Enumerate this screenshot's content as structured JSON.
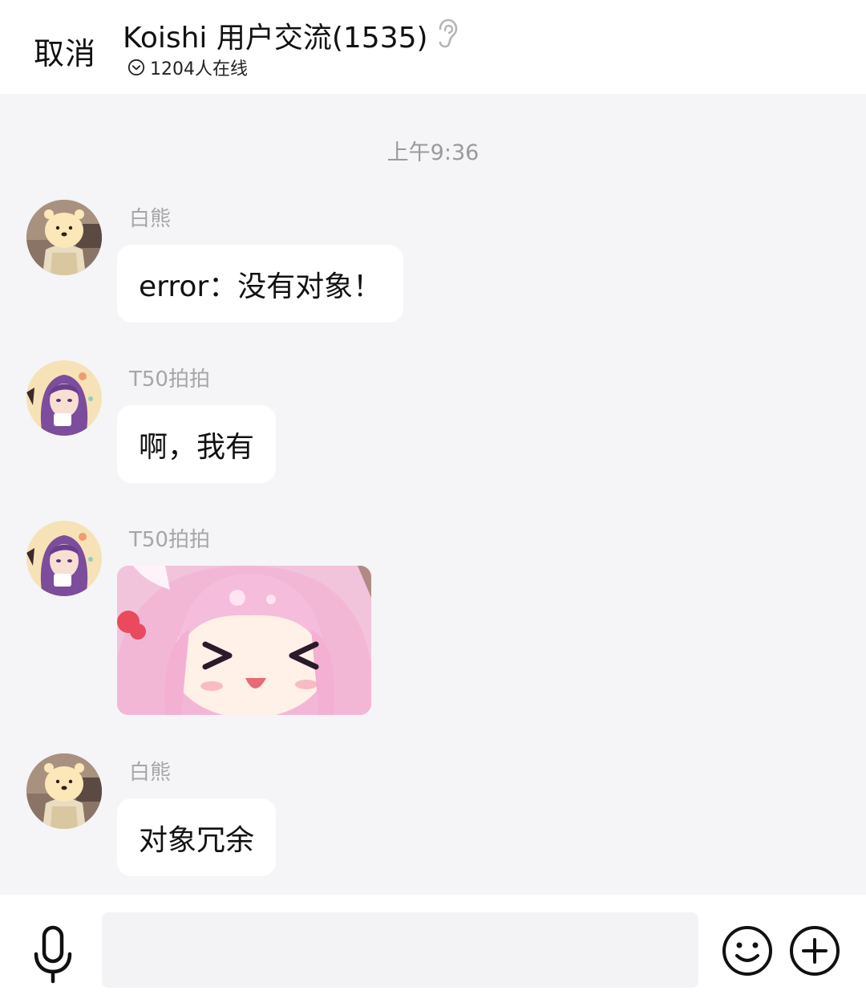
{
  "header": {
    "cancel_label": "取消",
    "title": "Koishi 用户交流(1535)",
    "online_text": "1204人在线",
    "ear_icon": "ear-icon",
    "online_icon": "chevron-down-circle-icon"
  },
  "chat": {
    "timestamp": "上午9:36",
    "messages": [
      {
        "sender": "白熊",
        "text": "error：没有对象！",
        "avatar": "polar-bear-avatar"
      },
      {
        "sender": "T50拍拍",
        "text": "啊，我有",
        "avatar": "purple-hair-girl-avatar"
      },
      {
        "sender": "T50拍拍",
        "sticker": "pink-hair-anime-girl-sticker",
        "avatar": "purple-hair-girl-avatar"
      },
      {
        "sender": "白熊",
        "text": "对象冗余",
        "avatar": "polar-bear-avatar"
      }
    ]
  },
  "composer": {
    "input_value": "",
    "mic_icon": "microphone-icon",
    "emoji_icon": "smiley-icon",
    "plus_icon": "plus-circle-icon"
  },
  "colors": {
    "background": "#f5f4f6",
    "bubble": "#ffffff",
    "sender_text": "#a6a6a6"
  }
}
